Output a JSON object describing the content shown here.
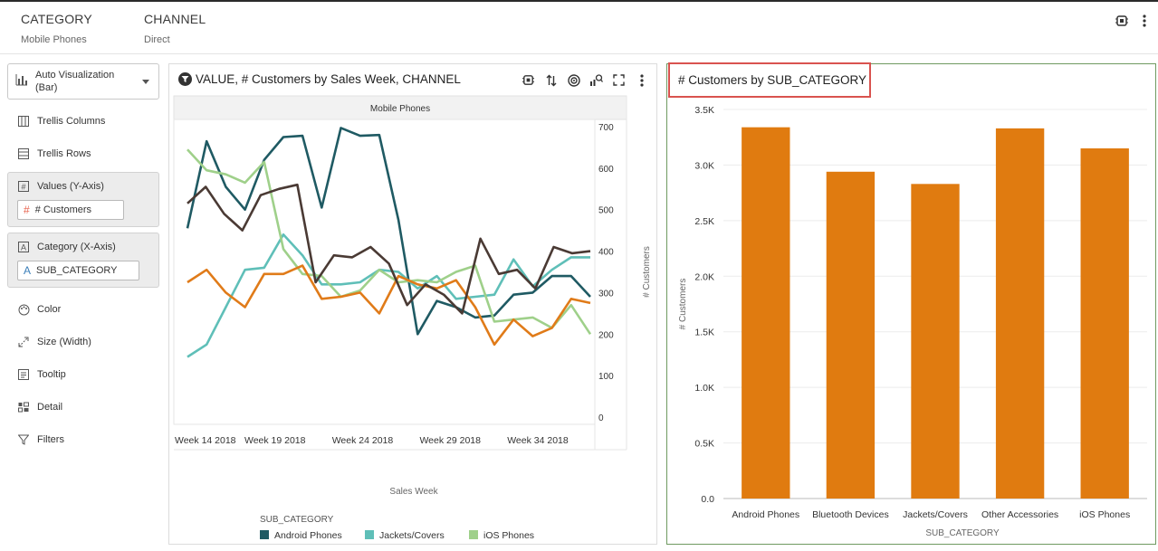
{
  "filters": [
    {
      "label": "CATEGORY",
      "value": "Mobile Phones"
    },
    {
      "label": "CHANNEL",
      "value": "Direct"
    }
  ],
  "grammar": {
    "viz_type": "Auto Visualization (Bar)",
    "trellis_columns": "Trellis Columns",
    "trellis_rows": "Trellis Rows",
    "values_title": "Values (Y-Axis)",
    "values_pill": "# Customers",
    "category_title": "Category (X-Axis)",
    "category_pill": "SUB_CATEGORY",
    "color": "Color",
    "size": "Size (Width)",
    "tooltip": "Tooltip",
    "detail": "Detail",
    "filters": "Filters"
  },
  "icons": {
    "header": [
      "ai-insights-icon",
      "more-vertical-icon"
    ],
    "toolbar": [
      "ai-insights-icon",
      "sort-icon",
      "target-icon",
      "explain-icon",
      "expand-icon",
      "more-vertical-icon"
    ]
  },
  "colors": {
    "android": "#1f5a63",
    "jackets": "#5fbfb8",
    "ios": "#9fd08a",
    "bluetooth": "#e07b19",
    "accessories": "#4a3a34",
    "bar": "#e07b10",
    "highlight": "#d9534f",
    "selected_border": "#6f9a61"
  },
  "chart_data": [
    {
      "type": "line",
      "title": "VALUE, # Customers by Sales Week, CHANNEL",
      "trellis_header": "Mobile Phones",
      "xlabel": "Sales Week",
      "ylabel": "# Customers",
      "xticks": [
        "Week 14 2018",
        "Week 19 2018",
        "Week 24 2018",
        "Week 29 2018",
        "Week 34 2018"
      ],
      "yticks": [
        "0",
        "100",
        "200",
        "300",
        "400",
        "500",
        "600",
        "700"
      ],
      "ylim": [
        0,
        700
      ],
      "x_start_week": 14,
      "x_end_week": 37,
      "legend_title": "SUB_CATEGORY",
      "legend": [
        "Android Phones",
        "Jackets/Covers",
        "iOS Phones",
        "Bluetooth Devices",
        "Other Accessories"
      ],
      "series": [
        {
          "name": "Android Phones",
          "color_key": "android",
          "values": [
            455,
            665,
            555,
            500,
            620,
            675,
            678,
            505,
            697,
            678,
            680,
            475,
            200,
            280,
            265,
            240,
            245,
            295,
            300,
            340,
            340,
            290
          ]
        },
        {
          "name": "Jackets/Covers",
          "color_key": "jackets",
          "values": [
            145,
            175,
            265,
            355,
            360,
            440,
            390,
            320,
            320,
            325,
            355,
            350,
            310,
            340,
            285,
            290,
            295,
            380,
            315,
            355,
            385,
            385
          ]
        },
        {
          "name": "iOS Phones",
          "color_key": "ios",
          "values": [
            645,
            595,
            585,
            565,
            615,
            405,
            345,
            340,
            290,
            305,
            355,
            325,
            330,
            325,
            350,
            365,
            230,
            235,
            240,
            215,
            270,
            200
          ]
        },
        {
          "name": "Bluetooth Devices",
          "color_key": "bluetooth",
          "values": [
            325,
            355,
            300,
            265,
            345,
            345,
            365,
            285,
            290,
            300,
            250,
            340,
            320,
            310,
            330,
            265,
            175,
            235,
            195,
            215,
            285,
            275
          ]
        },
        {
          "name": "Other Accessories",
          "color_key": "accessories",
          "values": [
            515,
            555,
            490,
            450,
            535,
            550,
            560,
            325,
            390,
            385,
            410,
            370,
            270,
            320,
            295,
            250,
            430,
            345,
            355,
            310,
            410,
            395,
            400
          ]
        }
      ]
    },
    {
      "type": "bar",
      "title": "# Customers by SUB_CATEGORY",
      "xlabel": "SUB_CATEGORY",
      "ylabel": "# Customers",
      "categories": [
        "Android Phones",
        "Bluetooth Devices",
        "Jackets/Covers",
        "Other Accessories",
        "iOS Phones"
      ],
      "values": [
        3340,
        2940,
        2830,
        3330,
        3150
      ],
      "yticks": [
        "0.0",
        "0.5K",
        "1.0K",
        "1.5K",
        "2.0K",
        "2.5K",
        "3.0K",
        "3.5K"
      ],
      "ylim": [
        0,
        3500
      ]
    }
  ]
}
